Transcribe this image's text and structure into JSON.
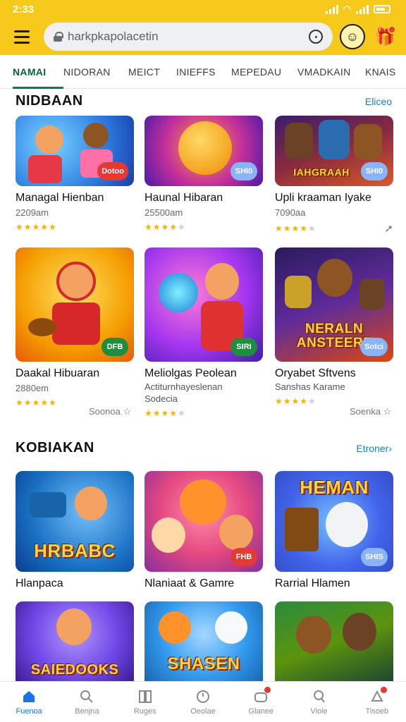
{
  "status": {
    "time": "2:33"
  },
  "search": {
    "url": "harkpkapolacetin"
  },
  "tabs": [
    "NAMAI",
    "NIDORAN",
    "MEICT",
    "INIEFFS",
    "MEPEDAU",
    "VMADKAIN",
    "KNAIS"
  ],
  "section1": {
    "title": "NIDBAAN",
    "more": "Eliceo",
    "cards": [
      {
        "title": "Managal Hienban",
        "sub": "2209am",
        "badge": "Dotoo",
        "stars": 5
      },
      {
        "title": "Haunal Hibaran",
        "sub": "25500am",
        "badge": "SHI0",
        "stars": 4.5
      },
      {
        "title": "Upli kraaman Iyake",
        "sub": "7090aa",
        "badge": "SHI0",
        "thumb_text": "IAHGRAAH",
        "stars": 3.5
      },
      {
        "title": "Daakal Hibuaran",
        "sub": "2880em",
        "badge": "DFB",
        "stars": 5,
        "meta": "Soonoa"
      },
      {
        "title": "Meliolgas Peolean",
        "sub": "Actiturnhayeslenan",
        "sub2": "Sodecia",
        "badge": "SIRI",
        "stars": 3.5
      },
      {
        "title": "Oryabet Sftvens",
        "sub": "Sanshas Karame",
        "badge": "Sotci",
        "thumb_text": "NERALN ANSTEERF",
        "stars": 3.5,
        "meta": "Soenka"
      }
    ]
  },
  "section2": {
    "title": "KOBIAKAN",
    "more": "Etroner",
    "cards": [
      {
        "title": "Hlanpaca",
        "thumb_text": "HRBABC"
      },
      {
        "title": "Nlaniaat & Gamre",
        "badge": "FHB"
      },
      {
        "title": "Rarrial Hlamen",
        "badge": "SHIS",
        "thumb_text": "HEMAN"
      },
      {
        "thumb_text": "SAIEDOOKS"
      },
      {
        "thumb_text": "SHASEN"
      },
      {}
    ]
  },
  "nav": [
    "Fuenoa",
    "Benjna",
    "Ruges",
    "Oeolae",
    "Glanee",
    "Viole",
    "Tisoeb"
  ],
  "colors": {
    "accent": "#f7c91a",
    "active_tab": "#0e7a4a",
    "nav_active": "#1a73e8",
    "link": "#1a7cc2"
  }
}
